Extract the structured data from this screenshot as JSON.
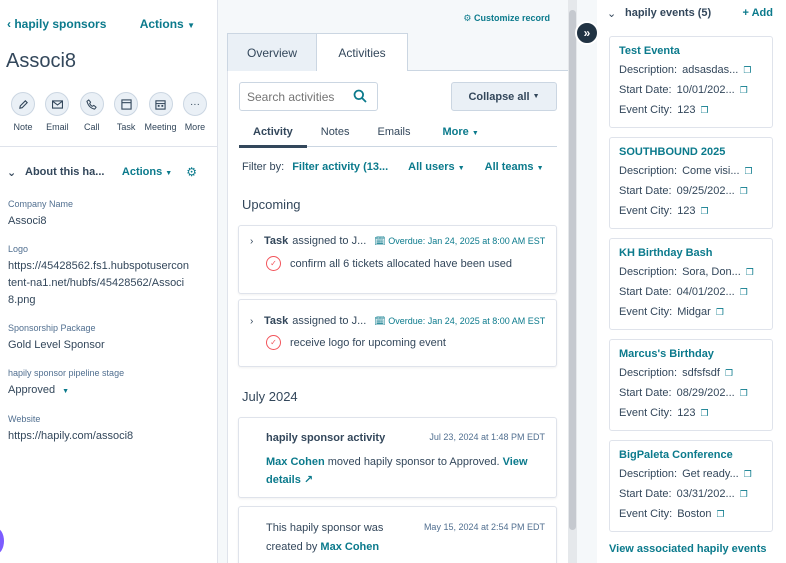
{
  "left": {
    "back_label": "hapily sponsors",
    "actions_label": "Actions",
    "record_name": "Associ8",
    "quick_actions": [
      {
        "label": "Note",
        "icon": "edit-icon"
      },
      {
        "label": "Email",
        "icon": "email-icon"
      },
      {
        "label": "Call",
        "icon": "phone-icon"
      },
      {
        "label": "Task",
        "icon": "task-icon"
      },
      {
        "label": "Meeting",
        "icon": "calendar-icon"
      },
      {
        "label": "More",
        "icon": "more-icon"
      }
    ],
    "about": {
      "title": "About this ha...",
      "actions_label": "Actions",
      "properties": [
        {
          "label": "Company Name",
          "value": "Associ8"
        },
        {
          "label": "Logo",
          "value": "https://45428562.fs1.hubspotusercontent-na1.net/hubfs/45428562/Associ8.png"
        },
        {
          "label": "Sponsorship Package",
          "value": "Gold Level Sponsor"
        },
        {
          "label": "hapily sponsor pipeline stage",
          "value": "Approved"
        },
        {
          "label": "Website",
          "value": "https://hapily.com/associ8"
        }
      ]
    }
  },
  "middle": {
    "customize_label": "Customize record",
    "tabs": [
      "Overview",
      "Activities"
    ],
    "search_placeholder": "Search activities",
    "collapse_label": "Collapse all",
    "subtabs": [
      "Activity",
      "Notes",
      "Emails",
      "More"
    ],
    "filter": {
      "label": "Filter by:",
      "activity": "Filter activity (13...",
      "users": "All users",
      "teams": "All teams"
    },
    "upcoming_label": "Upcoming",
    "tasks": [
      {
        "type": "Task",
        "assigned": "assigned to J...",
        "due": "Overdue: Jan 24, 2025 at 8:00 AM EST",
        "desc": "confirm all 6 tickets allocated have been used"
      },
      {
        "type": "Task",
        "assigned": "assigned to J...",
        "due": "Overdue: Jan 24, 2025 at 8:00 AM EST",
        "desc": "receive logo for upcoming event"
      }
    ],
    "july_label": "July 2024",
    "activity1": {
      "title": "hapily sponsor activity",
      "date": "Jul 23, 2024 at 1:48 PM EDT",
      "user": "Max Cohen",
      "text": " moved hapily sponsor to Approved. ",
      "link": "View details"
    },
    "activity2": {
      "text_a": "This hapily sponsor was",
      "text_b": "created by ",
      "user": "Max Cohen",
      "date": "May 15, 2024 at 2:54 PM EDT"
    }
  },
  "right": {
    "title": "hapily events (5)",
    "add_label": "+ Add",
    "k_desc": "Description:",
    "k_start": "Start Date:",
    "k_city": "Event City:",
    "events": [
      {
        "name": "Test Eventa",
        "description": "adsasdas...",
        "start": "10/01/202...",
        "city": "123"
      },
      {
        "name": "SOUTHBOUND 2025",
        "description": "Come visi...",
        "start": "09/25/202...",
        "city": "123"
      },
      {
        "name": "KH Birthday Bash",
        "description": "Sora, Don...",
        "start": "04/01/202...",
        "city": "Midgar"
      },
      {
        "name": "Marcus's Birthday",
        "description": "sdfsfsdf",
        "start": "08/29/202...",
        "city": "123"
      },
      {
        "name": "BigPaleta Conference",
        "description": "Get ready...",
        "start": "03/31/202...",
        "city": "Boston"
      }
    ],
    "view_all_label": "View associated hapily events"
  }
}
